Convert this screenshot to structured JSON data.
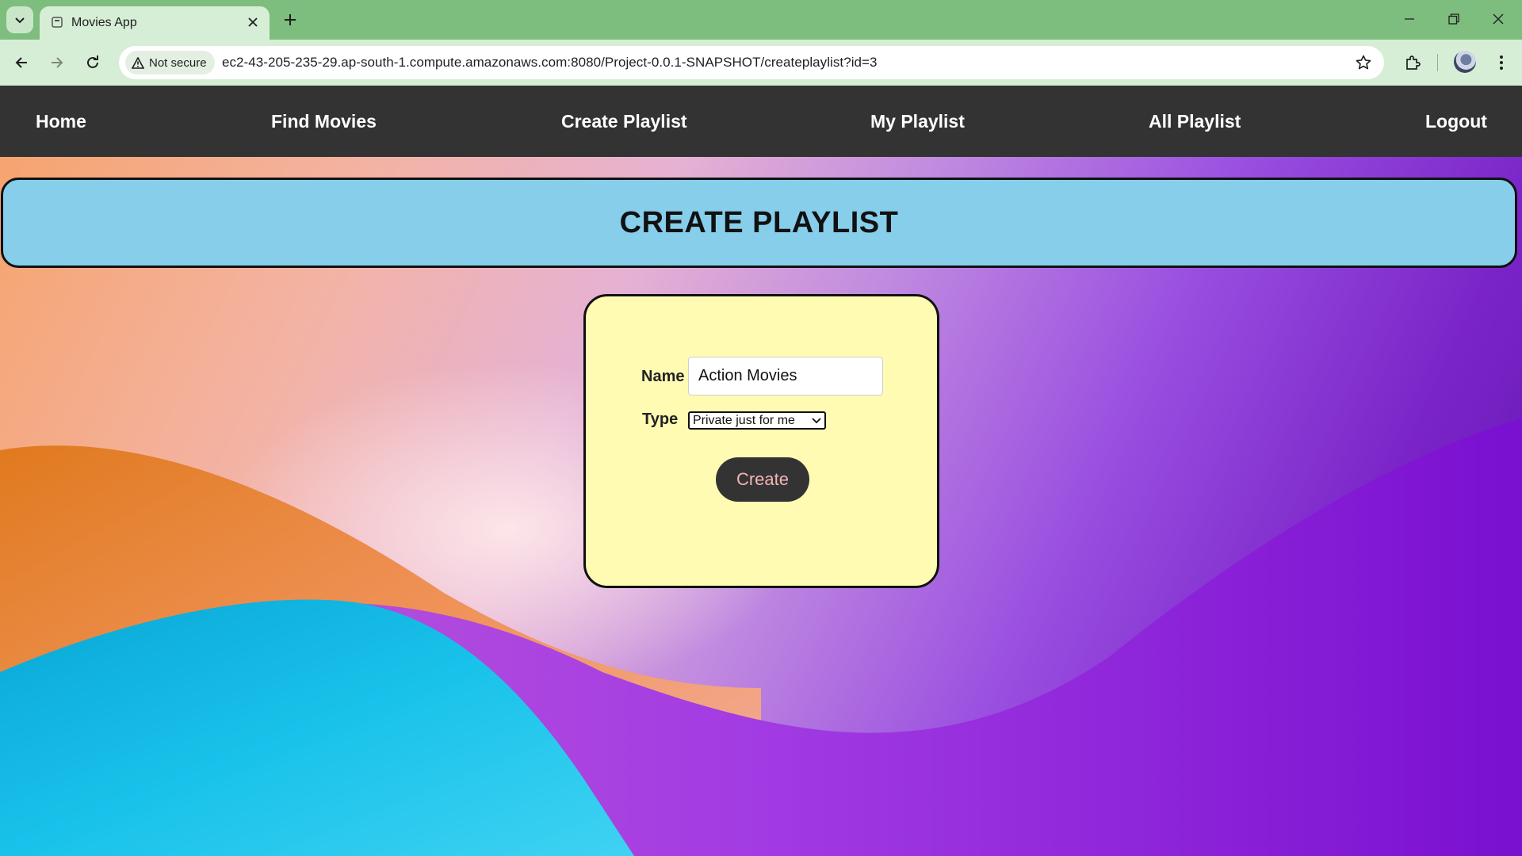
{
  "browser": {
    "tab_title": "Movies App",
    "security_label": "Not secure",
    "url": "ec2-43-205-235-29.ap-south-1.compute.amazonaws.com:8080/Project-0.0.1-SNAPSHOT/createplaylist?id=3"
  },
  "nav": {
    "items": [
      {
        "label": "Home"
      },
      {
        "label": "Find Movies"
      },
      {
        "label": "Create Playlist"
      },
      {
        "label": "My Playlist"
      },
      {
        "label": "All Playlist"
      },
      {
        "label": "Logout"
      }
    ]
  },
  "header": {
    "title": "CREATE PLAYLIST"
  },
  "form": {
    "name_label": "Name",
    "name_value": "Action Movies",
    "type_label": "Type",
    "type_selected": "Private just for me",
    "submit_label": "Create"
  },
  "colors": {
    "tab_strip": "#7dbd7d",
    "nav_bg": "#333333",
    "banner_bg": "#87ceeb",
    "card_bg": "#fffbb3",
    "button_bg": "#333333",
    "button_text": "#f5b4b4"
  },
  "icons": [
    "tab-search-icon",
    "page-favicon-icon",
    "close-tab-icon",
    "new-tab-icon",
    "minimize-icon",
    "restore-icon",
    "close-window-icon",
    "back-icon",
    "forward-icon",
    "reload-icon",
    "warning-icon",
    "bookmark-star-icon",
    "extensions-icon",
    "chrome-menu-icon",
    "chevron-down-icon"
  ]
}
